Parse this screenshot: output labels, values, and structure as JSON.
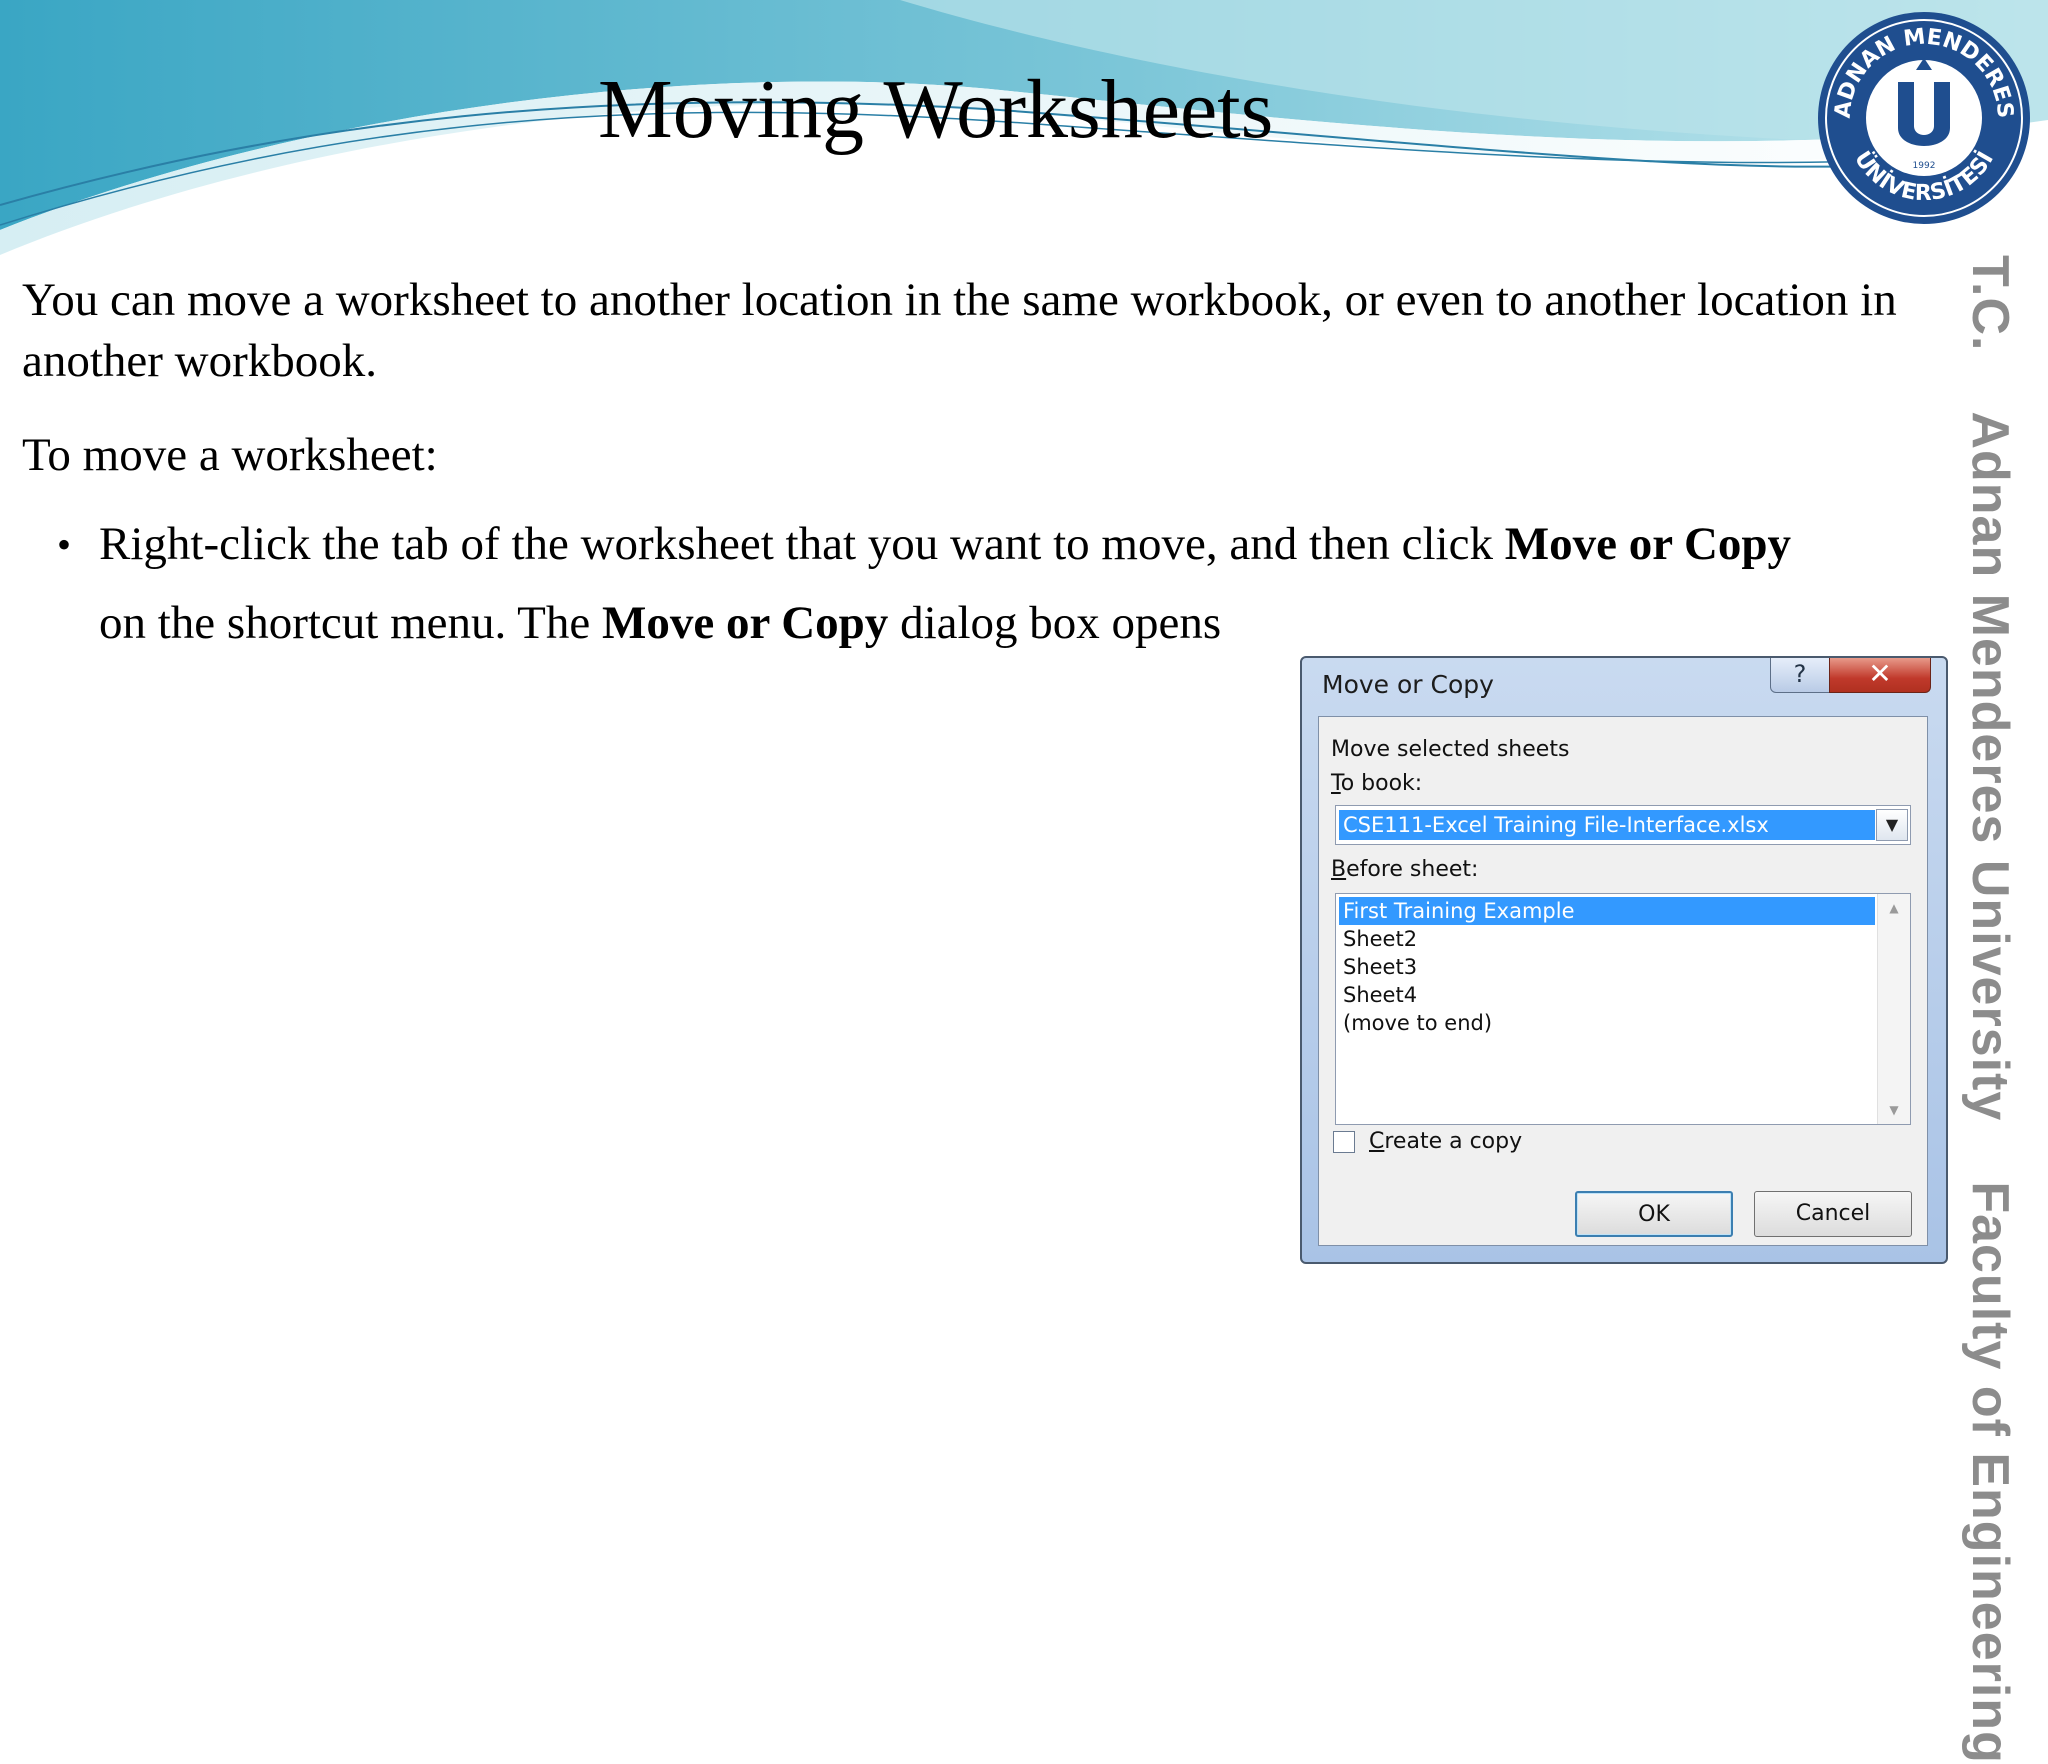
{
  "slide": {
    "title": "Moving Worksheets",
    "paragraph1": "You can move a worksheet to another location in the same workbook, or even to another location in another workbook.",
    "paragraph2": "To move a worksheet:",
    "bullet": {
      "marker": "•",
      "text_before": "Right-click the tab of the worksheet that you want to move, and then click ",
      "bold1": "Move or Copy",
      "text_middle": " on the shortcut menu. The ",
      "bold2": "Move or Copy",
      "text_after": " dialog box opens"
    }
  },
  "side_banner": {
    "prefix": "T.C.",
    "university": "Adnan Menderes University",
    "faculty": "Faculty of Engineering"
  },
  "seal": {
    "top_text": "ADNAN MENDERES",
    "bottom_text": "ÜNİVERSİTESİ",
    "year": "1992",
    "color": "#1f4e8f"
  },
  "dialog": {
    "title": "Move or Copy",
    "help_label": "?",
    "close_label": "✕",
    "move_label": "Move selected sheets",
    "to_book_label": {
      "first": "T",
      "rest": "o book:"
    },
    "to_book_value": "CSE111-Excel Training File-Interface.xlsx",
    "dropdown_arrow": "▼",
    "before_sheet_label": {
      "first": "B",
      "rest": "efore sheet:"
    },
    "sheets": [
      {
        "label": "First Training Example",
        "selected": true
      },
      {
        "label": "Sheet2",
        "selected": false
      },
      {
        "label": "Sheet3",
        "selected": false
      },
      {
        "label": "Sheet4",
        "selected": false
      },
      {
        "label": "(move to end)",
        "selected": false
      }
    ],
    "scroll_up": "▲",
    "scroll_down": "▼",
    "create_copy_label": {
      "first": "C",
      "rest": "reate a copy"
    },
    "create_copy_checked": false,
    "ok_label": "OK",
    "cancel_label": "Cancel",
    "selection_color": "#3399ff"
  },
  "colors": {
    "wave_dark": "#3aa6c4",
    "wave_light": "#a9dde6",
    "side_text": "#8c8c8c"
  }
}
